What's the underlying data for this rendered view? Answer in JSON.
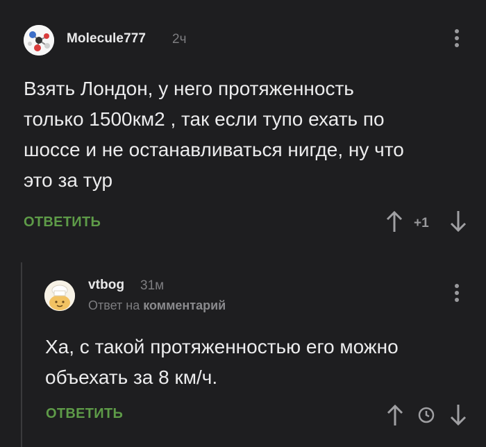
{
  "comments": [
    {
      "author": "Molecule777",
      "time": "2ч",
      "avatar_icon": "molecule-avatar-icon",
      "text": "Взять Лондон, у него протяженность\nтолько 1500км2 , так если тупо ехать по\nшоссе и не останавливаться нигде, ну что\nэто за тур",
      "reply_label": "ОТВЕТИТЬ",
      "score": "+1"
    },
    {
      "author": "vtbog",
      "time": "31м",
      "avatar_icon": "chef-avatar-icon",
      "reply_to_prefix": "Ответ на",
      "reply_to_target": "комментарий",
      "text": "Ха, с такой протяженностью его можно\nобъехать за 8 км/ч.",
      "reply_label": "ОТВЕТИТЬ",
      "score_icon": "clock-icon"
    }
  ],
  "colors": {
    "background": "#1e1e20",
    "text": "#ececed",
    "muted": "#7d7d80",
    "reply_accent": "#5e9b48",
    "thread_line": "#3a3a3c"
  }
}
